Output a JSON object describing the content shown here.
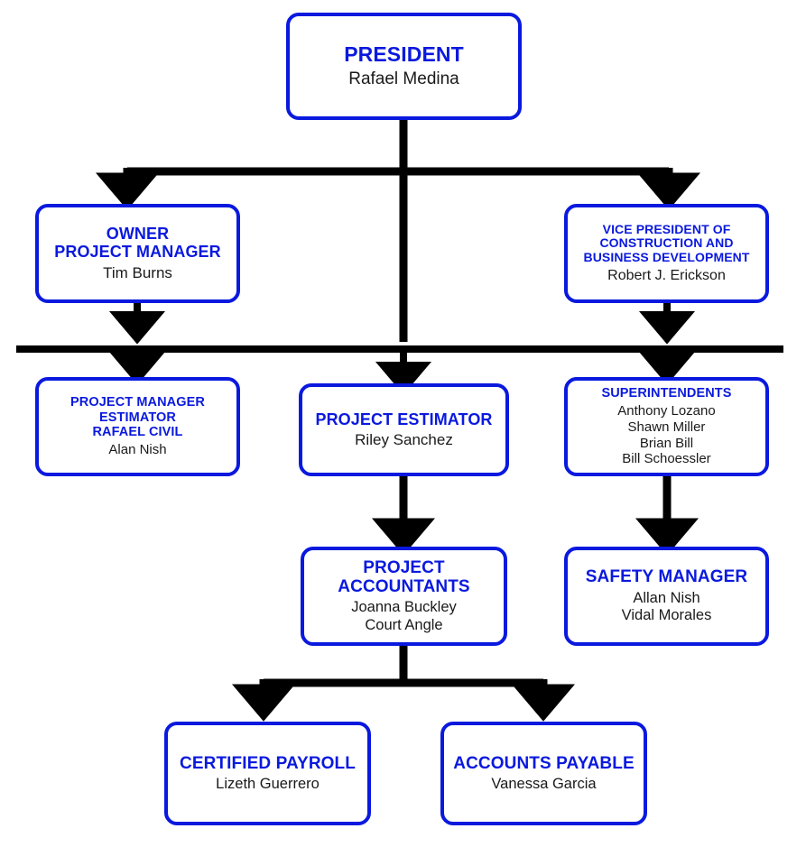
{
  "chart": {
    "type": "org-chart",
    "accent_color": "#0a19de",
    "text_color": "#1a1a1a",
    "connector_color": "#000000",
    "background": "#ffffff",
    "nodes": [
      {
        "id": "president",
        "title": "PRESIDENT",
        "people": "Rafael Medina"
      },
      {
        "id": "owner-project-manager",
        "title": "OWNER\nPROJECT MANAGER",
        "people": "Tim Burns"
      },
      {
        "id": "vice-president",
        "title": "VICE PRESIDENT OF\nCONSTRUCTION AND\nBUSINESS DEVELOPMENT",
        "people": "Robert J. Erickson"
      },
      {
        "id": "project-manager-estimator",
        "title": "PROJECT MANAGER\nESTIMATOR\nRAFAEL CIVIL",
        "people": "Alan Nish"
      },
      {
        "id": "project-estimator",
        "title": "PROJECT ESTIMATOR",
        "people": "Riley Sanchez"
      },
      {
        "id": "superintendents",
        "title": "SUPERINTENDENTS",
        "people": "Anthony Lozano\nShawn Miller\nBrian Bill\nBill Schoessler"
      },
      {
        "id": "project-accountants",
        "title": "PROJECT\nACCOUNTANTS",
        "people": "Joanna Buckley\nCourt Angle"
      },
      {
        "id": "safety-manager",
        "title": "SAFETY MANAGER",
        "people": "Allan Nish\nVidal Morales"
      },
      {
        "id": "certified-payroll",
        "title": "CERTIFIED PAYROLL",
        "people": "Lizeth Guerrero"
      },
      {
        "id": "accounts-payable",
        "title": "ACCOUNTS PAYABLE",
        "people": "Vanessa Garcia"
      }
    ]
  }
}
